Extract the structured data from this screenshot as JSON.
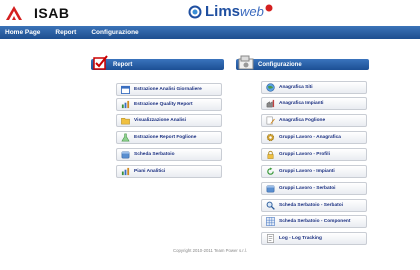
{
  "header": {
    "company": "ISAB",
    "app_name": "Lims",
    "app_suffix": "web"
  },
  "nav": {
    "items": [
      {
        "label": "Home Page"
      },
      {
        "label": "Report"
      },
      {
        "label": "Configurazione"
      }
    ]
  },
  "report_panel": {
    "title": "Report",
    "items": [
      {
        "label": "Estrazione Analisi Giornaliere",
        "icon": "calendar-icon"
      },
      {
        "label": "Estrazione Quality Report",
        "icon": "chart-icon"
      },
      {
        "label": "Visualizzazione Analisi",
        "icon": "folder-icon"
      },
      {
        "label": "Estrazione Report Foglione",
        "icon": "flask-icon"
      },
      {
        "label": "Scheda Serbatoio",
        "icon": "tank-icon"
      },
      {
        "label": "Piani Analitici",
        "icon": "chart-icon"
      }
    ]
  },
  "config_panel": {
    "title": "Configurazione",
    "items": [
      {
        "label": "Anagrafica Siti",
        "icon": "globe-icon"
      },
      {
        "label": "Anagrafica Impianti",
        "icon": "plant-icon"
      },
      {
        "label": "Anagrafica Foglione",
        "icon": "edit-icon"
      },
      {
        "label": "Gruppi Lavoro - Anagrafica",
        "icon": "gear-icon"
      },
      {
        "label": "Gruppi Lavoro - Profili",
        "icon": "lock-icon"
      },
      {
        "label": "Gruppi Lavoro - Impianti",
        "icon": "refresh-icon"
      },
      {
        "label": "Gruppi Lavoro - Serbatoi",
        "icon": "tank-icon"
      },
      {
        "label": "Scheda Serbatoio - Serbatoi",
        "icon": "search-icon"
      },
      {
        "label": "Scheda Serbatoio - Component",
        "icon": "grid-icon"
      },
      {
        "label": "Log - Log Tracking",
        "icon": "log-icon"
      }
    ]
  },
  "footer": {
    "copyright": "Copyright 2010-2011 Team Power s.r.l."
  },
  "colors": {
    "nav_bar": "#1d4e8f",
    "panel_header": "#2a62a8",
    "button_text": "#1a2f80",
    "brand_red": "#d42020"
  }
}
